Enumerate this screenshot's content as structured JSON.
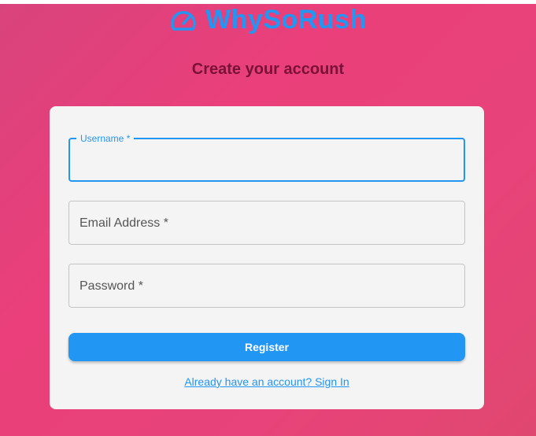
{
  "brand": {
    "name": "WhySoRush",
    "icon": "speedometer-icon",
    "color": "#2196f3"
  },
  "page": {
    "title": "Create your account"
  },
  "form": {
    "fields": [
      {
        "label": "Username *",
        "value": "",
        "focused": true
      },
      {
        "label": "Email Address *",
        "value": "",
        "focused": false
      },
      {
        "label": "Password *",
        "value": "",
        "focused": false
      }
    ],
    "register_label": "Register",
    "signin_link": "Already have an account? Sign In"
  },
  "colors": {
    "accent": "#2196f3",
    "background": "#e8437a",
    "card": "#f4f4f4",
    "title": "#7a1237"
  }
}
